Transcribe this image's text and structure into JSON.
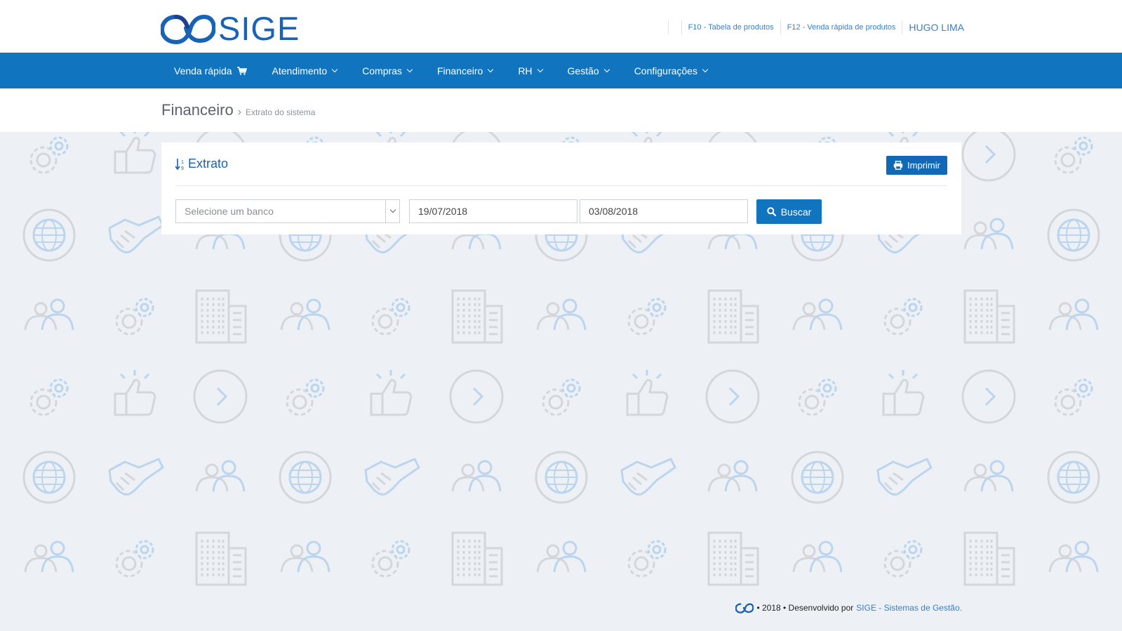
{
  "brand": {
    "name": "SIGE"
  },
  "top_links": [
    {
      "label": "F10 - Tabela de produtos"
    },
    {
      "label": "F12 - Venda rápida de produtos"
    }
  ],
  "user": {
    "name": "HUGO LIMA"
  },
  "nav": [
    {
      "label": "Venda rápida",
      "icon": "cart-icon"
    },
    {
      "label": "Atendimento"
    },
    {
      "label": "Compras"
    },
    {
      "label": "Financeiro"
    },
    {
      "label": "RH"
    },
    {
      "label": "Gestão"
    },
    {
      "label": "Configurações"
    }
  ],
  "breadcrumb": {
    "section": "Financeiro",
    "page": "Extrato do sistema"
  },
  "panel": {
    "title": "Extrato",
    "print_label": "Imprimir",
    "bank_select": {
      "placeholder": "Selecione um banco"
    },
    "date_from": "19/07/2018",
    "date_to": "03/08/2018",
    "search_label": "Buscar"
  },
  "footer": {
    "text": "• 2018 • Desenvolvido por",
    "link": "SIGE - Sistemas de Gestão."
  },
  "colors": {
    "primary": "#1174bf",
    "accent_text": "#3a7fc4",
    "background": "#edf0f4"
  }
}
